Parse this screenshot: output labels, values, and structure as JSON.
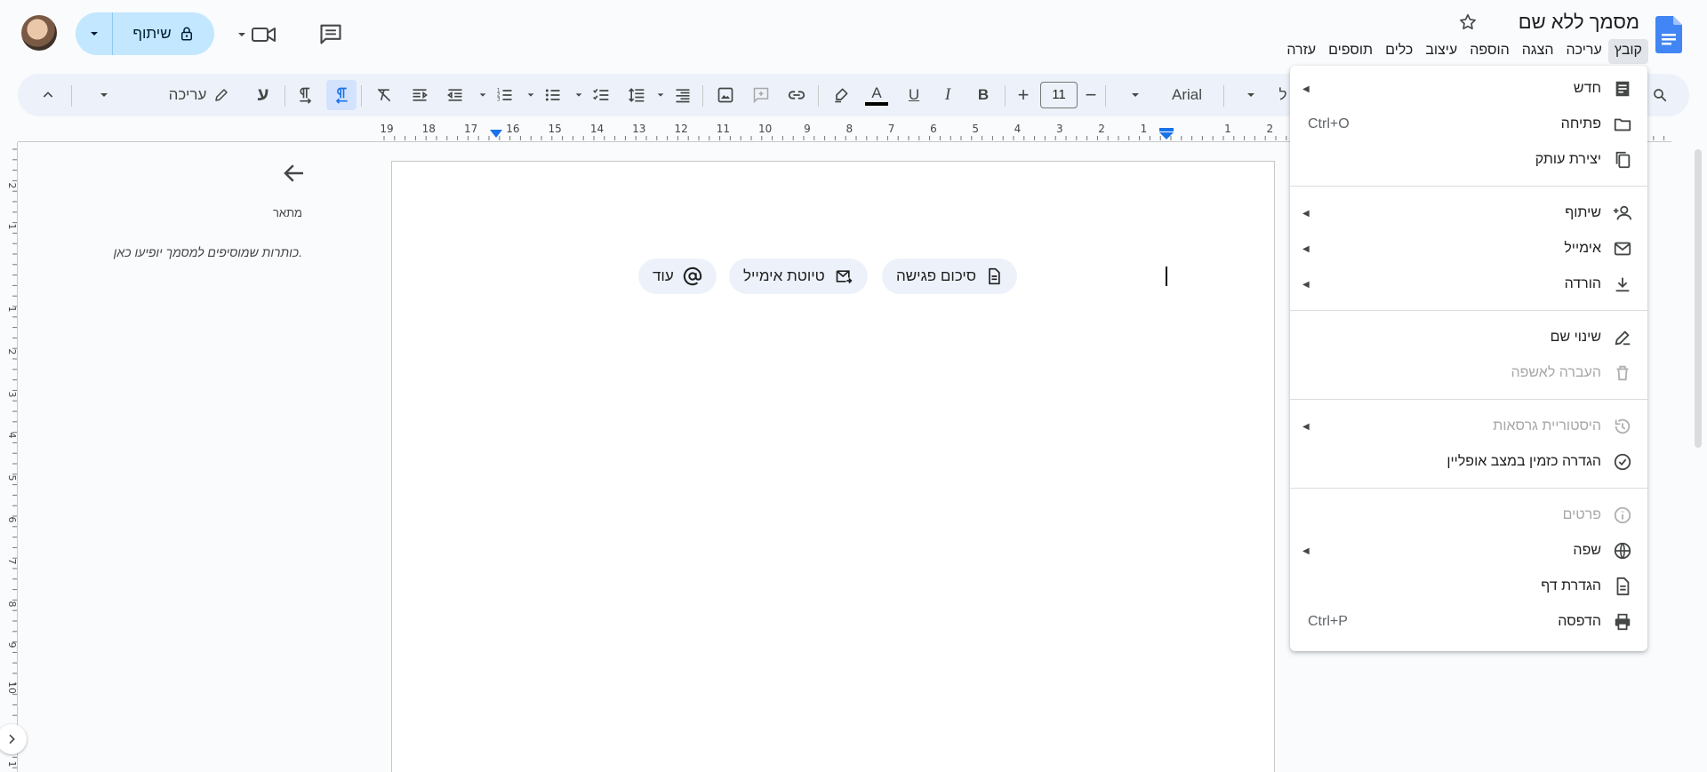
{
  "header": {
    "doc_title": "מסמך ללא שם",
    "share_label": "שיתוף"
  },
  "menubar": [
    "קובץ",
    "עריכה",
    "הצגה",
    "הוספה",
    "עיצוב",
    "כלים",
    "תוספים",
    "עזרה"
  ],
  "toolbar": {
    "font_name": "Arial",
    "font_size": "11",
    "editing_mode": "עריכה",
    "bold_label": "B",
    "italic_label": "I",
    "underline_label": "U",
    "text_color_label": "A",
    "hebrew_label": "ע",
    "overflow_label": "ל"
  },
  "ruler": {
    "top_numbers": [
      "19",
      "18",
      "17",
      "16",
      "15",
      "14",
      "13",
      "12",
      "11",
      "10",
      "9",
      "8",
      "7",
      "6",
      "5",
      "4",
      "3",
      "2",
      "1",
      "",
      "1",
      "2"
    ],
    "left_numbers": [
      "2",
      "1",
      "",
      "1",
      "2",
      "3",
      "4",
      "5",
      "6",
      "7",
      "8",
      "9",
      "10",
      "1"
    ]
  },
  "outline": {
    "title": "מתאר",
    "empty_text": "כותרות שמוסיפים למסמך יופיעו כאן."
  },
  "chips": {
    "meeting_notes": "סיכום פגישה",
    "email_draft": "טיוטת אימייל",
    "more": "עוד"
  },
  "file_menu": {
    "items": [
      {
        "label": "חדש",
        "icon": "new-doc-icon",
        "submenu": true,
        "shortcut": "",
        "disabled": false
      },
      {
        "label": "פתיחה",
        "icon": "folder-icon",
        "submenu": false,
        "shortcut": "Ctrl+O",
        "disabled": false
      },
      {
        "label": "יצירת עותק",
        "icon": "copy-icon",
        "submenu": false,
        "shortcut": "",
        "disabled": false
      },
      {
        "label": "שיתוף",
        "icon": "person-add-icon",
        "submenu": true,
        "shortcut": "",
        "disabled": false
      },
      {
        "label": "אימייל",
        "icon": "mail-icon",
        "submenu": true,
        "shortcut": "",
        "disabled": false
      },
      {
        "label": "הורדה",
        "icon": "download-icon",
        "submenu": true,
        "shortcut": "",
        "disabled": false
      },
      {
        "label": "שינוי שם",
        "icon": "rename-icon",
        "submenu": false,
        "shortcut": "",
        "disabled": false
      },
      {
        "label": "העברה לאשפה",
        "icon": "trash-icon",
        "submenu": false,
        "shortcut": "",
        "disabled": true
      },
      {
        "label": "היסטוריית גרסאות",
        "icon": "history-icon",
        "submenu": true,
        "shortcut": "",
        "disabled": true
      },
      {
        "label": "הגדרה כזמין במצב אופליין",
        "icon": "offline-icon",
        "submenu": false,
        "shortcut": "",
        "disabled": false
      },
      {
        "label": "פרטים",
        "icon": "info-icon",
        "submenu": false,
        "shortcut": "",
        "disabled": true
      },
      {
        "label": "שפה",
        "icon": "globe-icon",
        "submenu": true,
        "shortcut": "",
        "disabled": false
      },
      {
        "label": "הגדרת דף",
        "icon": "page-setup-icon",
        "submenu": false,
        "shortcut": "",
        "disabled": false
      },
      {
        "label": "הדפסה",
        "icon": "print-icon",
        "submenu": false,
        "shortcut": "Ctrl+P",
        "disabled": false
      }
    ]
  }
}
